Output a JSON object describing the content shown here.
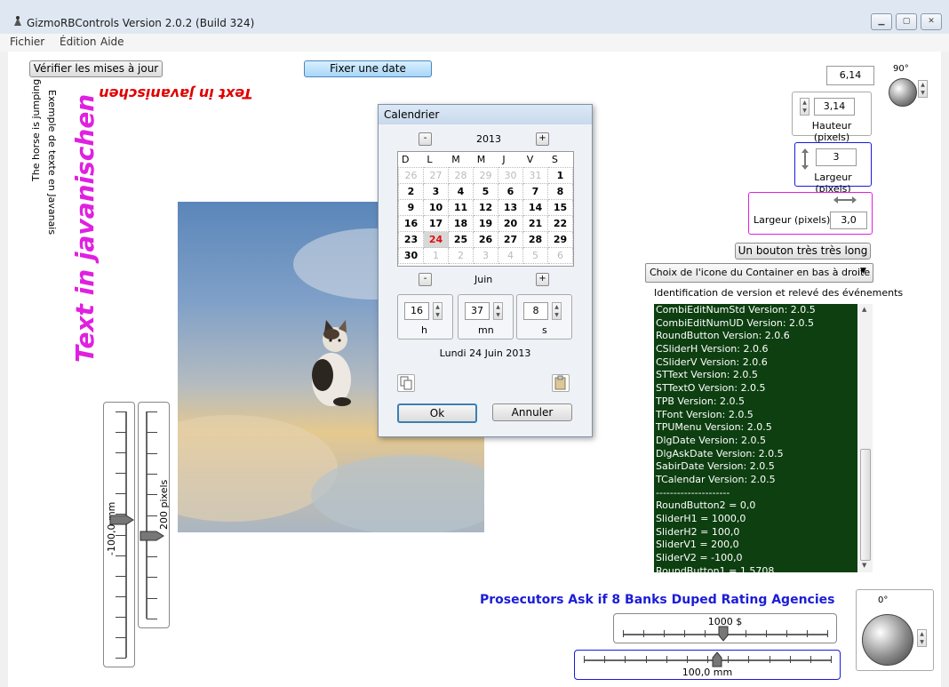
{
  "window": {
    "title": "GizmoRBControls  Version 2.0.2 (Build 324)",
    "menu": [
      "Fichier",
      "Édition",
      "Aide"
    ],
    "buttons": [
      "minimize",
      "maximize",
      "close"
    ]
  },
  "top": {
    "check_updates": "Vérifier les mises à jour",
    "set_date": "Fixer une date",
    "value_top": "6,14",
    "angle_top": "90°"
  },
  "texts": {
    "mirrored": "Text in javanischen",
    "horse": "The horse is jumping",
    "javanais": "Exemple de texte en Javanais",
    "big_vertical": "Text in javanischen",
    "headline": "Prosecutors Ask if 8 Banks Duped Rating Agencies"
  },
  "right": {
    "hauteur_value": "3,14",
    "hauteur_label": "Hauteur (pixels)",
    "largeur_value": "3",
    "largeur_label": "Largeur (pixels)",
    "largeur2_label": "Largeur (pixels)",
    "largeur2_value": "3,0",
    "long_button": "Un bouton très très long",
    "icon_choice": "Choix de l'icone du Container en bas à droite",
    "log_title": "Identification de version et relevé des événements",
    "log_lines": [
      "CombiEditNumStd Version: 2.0.5",
      "CombiEditNumUD Version: 2.0.5",
      "RoundButton Version: 2.0.6",
      "CSliderH Version: 2.0.6",
      "CSliderV Version: 2.0.6",
      "STText Version: 2.0.5",
      "STTextO Version: 2.0.5",
      "TPB Version: 2.0.5",
      "TFont Version: 2.0.5",
      "TPUMenu Version: 2.0.5",
      "DlgDate Version: 2.0.5",
      "DlgAskDate Version: 2.0.5",
      "SabirDate Version: 2.0.5",
      "TCalendar Version: 2.0.5",
      "---------------------",
      "RoundButton2 = 0,0",
      "SliderH1 = 1000,0",
      "SliderH2 = 100,0",
      "SliderV1 = 200,0",
      "SliderV2 = -100,0",
      "RoundButton1 = 1,5708"
    ],
    "angle_bottom": "0°"
  },
  "sliders": {
    "v1_label": "-100,0 mm",
    "v1_level": 0.44,
    "v2_label": "200 pixels",
    "v2_level": 0.6,
    "h1_label": "1000 $",
    "h1_level": 0.49,
    "h2_label": "100,0 mm",
    "h2_level": 0.54
  },
  "calendar": {
    "title": "Calendrier",
    "year": "2013",
    "month": "Juin",
    "minus": "-",
    "plus": "+",
    "weekdays": [
      "D",
      "L",
      "M",
      "M",
      "J",
      "V",
      "S"
    ],
    "weeks": [
      [
        "26",
        "27",
        "28",
        "29",
        "30",
        "31",
        "1"
      ],
      [
        "2",
        "3",
        "4",
        "5",
        "6",
        "7",
        "8"
      ],
      [
        "9",
        "10",
        "11",
        "12",
        "13",
        "14",
        "15"
      ],
      [
        "16",
        "17",
        "18",
        "19",
        "20",
        "21",
        "22"
      ],
      [
        "23",
        "24",
        "25",
        "26",
        "27",
        "28",
        "29"
      ],
      [
        "30",
        "1",
        "2",
        "3",
        "4",
        "5",
        "6"
      ]
    ],
    "selected_day": "24",
    "hour": "16",
    "hour_unit": "h",
    "minute": "37",
    "minute_unit": "mn",
    "second": "8",
    "second_unit": "s",
    "date_text": "Lundi 24 Juin 2013",
    "ok": "Ok",
    "cancel": "Annuler"
  },
  "colors": {
    "log_bg": "#0d3f10",
    "accent_magenta": "#e020e0",
    "headline_blue": "#1c1cd8",
    "selected_day_red": "#e01010"
  }
}
